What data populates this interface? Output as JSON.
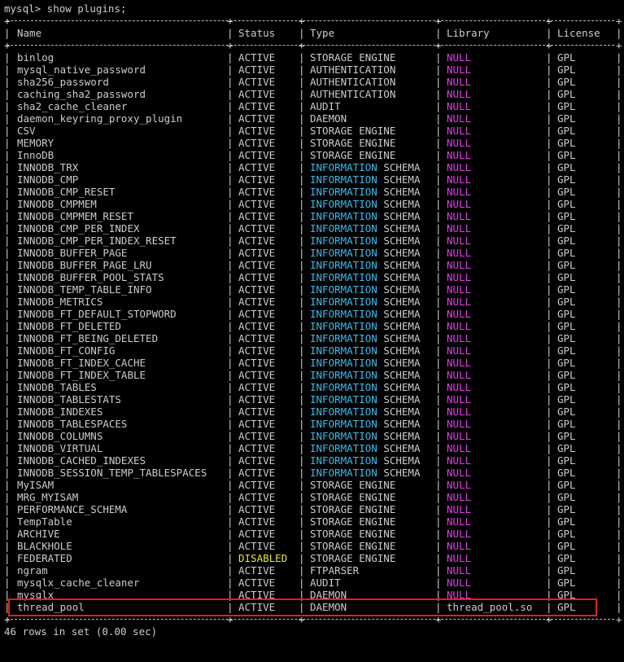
{
  "prompt": "mysql> show plugins;",
  "headers": [
    "Name",
    "Status",
    "Type",
    "Library",
    "License"
  ],
  "rows": [
    {
      "name": "binlog",
      "status": "ACTIVE",
      "type_a": "STORAGE ENGINE",
      "type_b": "",
      "lib": "NULL",
      "lic": "GPL"
    },
    {
      "name": "mysql_native_password",
      "status": "ACTIVE",
      "type_a": "AUTHENTICATION",
      "type_b": "",
      "lib": "NULL",
      "lic": "GPL"
    },
    {
      "name": "sha256_password",
      "status": "ACTIVE",
      "type_a": "AUTHENTICATION",
      "type_b": "",
      "lib": "NULL",
      "lic": "GPL"
    },
    {
      "name": "caching_sha2_password",
      "status": "ACTIVE",
      "type_a": "AUTHENTICATION",
      "type_b": "",
      "lib": "NULL",
      "lic": "GPL"
    },
    {
      "name": "sha2_cache_cleaner",
      "status": "ACTIVE",
      "type_a": "AUDIT",
      "type_b": "",
      "lib": "NULL",
      "lic": "GPL"
    },
    {
      "name": "daemon_keyring_proxy_plugin",
      "status": "ACTIVE",
      "type_a": "DAEMON",
      "type_b": "",
      "lib": "NULL",
      "lic": "GPL"
    },
    {
      "name": "CSV",
      "status": "ACTIVE",
      "type_a": "STORAGE ENGINE",
      "type_b": "",
      "lib": "NULL",
      "lic": "GPL"
    },
    {
      "name": "MEMORY",
      "status": "ACTIVE",
      "type_a": "STORAGE ENGINE",
      "type_b": "",
      "lib": "NULL",
      "lic": "GPL"
    },
    {
      "name": "InnoDB",
      "status": "ACTIVE",
      "type_a": "STORAGE ENGINE",
      "type_b": "",
      "lib": "NULL",
      "lic": "GPL"
    },
    {
      "name": "INNODB_TRX",
      "status": "ACTIVE",
      "type_a": "INFORMATION",
      "type_b": " SCHEMA",
      "lib": "NULL",
      "lic": "GPL"
    },
    {
      "name": "INNODB_CMP",
      "status": "ACTIVE",
      "type_a": "INFORMATION",
      "type_b": " SCHEMA",
      "lib": "NULL",
      "lic": "GPL"
    },
    {
      "name": "INNODB_CMP_RESET",
      "status": "ACTIVE",
      "type_a": "INFORMATION",
      "type_b": " SCHEMA",
      "lib": "NULL",
      "lic": "GPL"
    },
    {
      "name": "INNODB_CMPMEM",
      "status": "ACTIVE",
      "type_a": "INFORMATION",
      "type_b": " SCHEMA",
      "lib": "NULL",
      "lic": "GPL"
    },
    {
      "name": "INNODB_CMPMEM_RESET",
      "status": "ACTIVE",
      "type_a": "INFORMATION",
      "type_b": " SCHEMA",
      "lib": "NULL",
      "lic": "GPL"
    },
    {
      "name": "INNODB_CMP_PER_INDEX",
      "status": "ACTIVE",
      "type_a": "INFORMATION",
      "type_b": " SCHEMA",
      "lib": "NULL",
      "lic": "GPL"
    },
    {
      "name": "INNODB_CMP_PER_INDEX_RESET",
      "status": "ACTIVE",
      "type_a": "INFORMATION",
      "type_b": " SCHEMA",
      "lib": "NULL",
      "lic": "GPL"
    },
    {
      "name": "INNODB_BUFFER_PAGE",
      "status": "ACTIVE",
      "type_a": "INFORMATION",
      "type_b": " SCHEMA",
      "lib": "NULL",
      "lic": "GPL"
    },
    {
      "name": "INNODB_BUFFER_PAGE_LRU",
      "status": "ACTIVE",
      "type_a": "INFORMATION",
      "type_b": " SCHEMA",
      "lib": "NULL",
      "lic": "GPL"
    },
    {
      "name": "INNODB_BUFFER_POOL_STATS",
      "status": "ACTIVE",
      "type_a": "INFORMATION",
      "type_b": " SCHEMA",
      "lib": "NULL",
      "lic": "GPL"
    },
    {
      "name": "INNODB_TEMP_TABLE_INFO",
      "status": "ACTIVE",
      "type_a": "INFORMATION",
      "type_b": " SCHEMA",
      "lib": "NULL",
      "lic": "GPL"
    },
    {
      "name": "INNODB_METRICS",
      "status": "ACTIVE",
      "type_a": "INFORMATION",
      "type_b": " SCHEMA",
      "lib": "NULL",
      "lic": "GPL"
    },
    {
      "name": "INNODB_FT_DEFAULT_STOPWORD",
      "status": "ACTIVE",
      "type_a": "INFORMATION",
      "type_b": " SCHEMA",
      "lib": "NULL",
      "lic": "GPL"
    },
    {
      "name": "INNODB_FT_DELETED",
      "status": "ACTIVE",
      "type_a": "INFORMATION",
      "type_b": " SCHEMA",
      "lib": "NULL",
      "lic": "GPL"
    },
    {
      "name": "INNODB_FT_BEING_DELETED",
      "status": "ACTIVE",
      "type_a": "INFORMATION",
      "type_b": " SCHEMA",
      "lib": "NULL",
      "lic": "GPL"
    },
    {
      "name": "INNODB_FT_CONFIG",
      "status": "ACTIVE",
      "type_a": "INFORMATION",
      "type_b": " SCHEMA",
      "lib": "NULL",
      "lic": "GPL"
    },
    {
      "name": "INNODB_FT_INDEX_CACHE",
      "status": "ACTIVE",
      "type_a": "INFORMATION",
      "type_b": " SCHEMA",
      "lib": "NULL",
      "lic": "GPL"
    },
    {
      "name": "INNODB_FT_INDEX_TABLE",
      "status": "ACTIVE",
      "type_a": "INFORMATION",
      "type_b": " SCHEMA",
      "lib": "NULL",
      "lic": "GPL"
    },
    {
      "name": "INNODB_TABLES",
      "status": "ACTIVE",
      "type_a": "INFORMATION",
      "type_b": " SCHEMA",
      "lib": "NULL",
      "lic": "GPL"
    },
    {
      "name": "INNODB_TABLESTATS",
      "status": "ACTIVE",
      "type_a": "INFORMATION",
      "type_b": " SCHEMA",
      "lib": "NULL",
      "lic": "GPL"
    },
    {
      "name": "INNODB_INDEXES",
      "status": "ACTIVE",
      "type_a": "INFORMATION",
      "type_b": " SCHEMA",
      "lib": "NULL",
      "lic": "GPL"
    },
    {
      "name": "INNODB_TABLESPACES",
      "status": "ACTIVE",
      "type_a": "INFORMATION",
      "type_b": " SCHEMA",
      "lib": "NULL",
      "lic": "GPL"
    },
    {
      "name": "INNODB_COLUMNS",
      "status": "ACTIVE",
      "type_a": "INFORMATION",
      "type_b": " SCHEMA",
      "lib": "NULL",
      "lic": "GPL"
    },
    {
      "name": "INNODB_VIRTUAL",
      "status": "ACTIVE",
      "type_a": "INFORMATION",
      "type_b": " SCHEMA",
      "lib": "NULL",
      "lic": "GPL"
    },
    {
      "name": "INNODB_CACHED_INDEXES",
      "status": "ACTIVE",
      "type_a": "INFORMATION",
      "type_b": " SCHEMA",
      "lib": "NULL",
      "lic": "GPL"
    },
    {
      "name": "INNODB_SESSION_TEMP_TABLESPACES",
      "status": "ACTIVE",
      "type_a": "INFORMATION",
      "type_b": " SCHEMA",
      "lib": "NULL",
      "lic": "GPL"
    },
    {
      "name": "MyISAM",
      "status": "ACTIVE",
      "type_a": "STORAGE ENGINE",
      "type_b": "",
      "lib": "NULL",
      "lic": "GPL"
    },
    {
      "name": "MRG_MYISAM",
      "status": "ACTIVE",
      "type_a": "STORAGE ENGINE",
      "type_b": "",
      "lib": "NULL",
      "lic": "GPL"
    },
    {
      "name": "PERFORMANCE_SCHEMA",
      "status": "ACTIVE",
      "type_a": "STORAGE ENGINE",
      "type_b": "",
      "lib": "NULL",
      "lic": "GPL"
    },
    {
      "name": "TempTable",
      "status": "ACTIVE",
      "type_a": "STORAGE ENGINE",
      "type_b": "",
      "lib": "NULL",
      "lic": "GPL"
    },
    {
      "name": "ARCHIVE",
      "status": "ACTIVE",
      "type_a": "STORAGE ENGINE",
      "type_b": "",
      "lib": "NULL",
      "lic": "GPL"
    },
    {
      "name": "BLACKHOLE",
      "status": "ACTIVE",
      "type_a": "STORAGE ENGINE",
      "type_b": "",
      "lib": "NULL",
      "lic": "GPL"
    },
    {
      "name": "FEDERATED",
      "status": "DISABLED",
      "type_a": "STORAGE ENGINE",
      "type_b": "",
      "lib": "NULL",
      "lic": "GPL"
    },
    {
      "name": "ngram",
      "status": "ACTIVE",
      "type_a": "FTPARSER",
      "type_b": "",
      "lib": "NULL",
      "lic": "GPL"
    },
    {
      "name": "mysqlx_cache_cleaner",
      "status": "ACTIVE",
      "type_a": "AUDIT",
      "type_b": "",
      "lib": "NULL",
      "lic": "GPL"
    },
    {
      "name": "mysqlx",
      "status": "ACTIVE",
      "type_a": "DAEMON",
      "type_b": "",
      "lib": "NULL",
      "lic": "GPL"
    },
    {
      "name": "thread_pool",
      "status": "ACTIVE",
      "type_a": "DAEMON",
      "type_b": "",
      "lib": "thread_pool.so",
      "lic": "GPL"
    }
  ],
  "footer": "46 rows in set (0.00 sec)",
  "colors": {
    "background": "#000000",
    "text": "#cccccc",
    "null": "#e040e8",
    "information": "#3fb8e8",
    "disabled": "#e8e83c",
    "highlight": "#e0201c"
  }
}
